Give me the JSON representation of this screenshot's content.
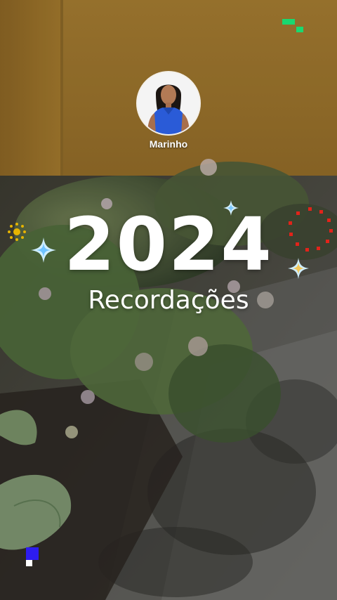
{
  "profile": {
    "name": "Marinho"
  },
  "story": {
    "year": "2024",
    "subtitle": "Recordações"
  },
  "colors": {
    "wall": "#a37a2c",
    "pixel_green": "#19d970",
    "pixel_blue": "#2d1cf0",
    "red_ring": "#e2231a",
    "yellow_sun": "#e6b400",
    "sparkle": "#bfe6ff"
  },
  "icons": {
    "green_pixels": "green-pixel-blocks-icon",
    "blue_pixels": "blue-pixel-blocks-icon",
    "red_ring": "red-dot-ring-icon",
    "sun": "yellow-sun-icon",
    "sparkles": "sparkle-icon"
  }
}
